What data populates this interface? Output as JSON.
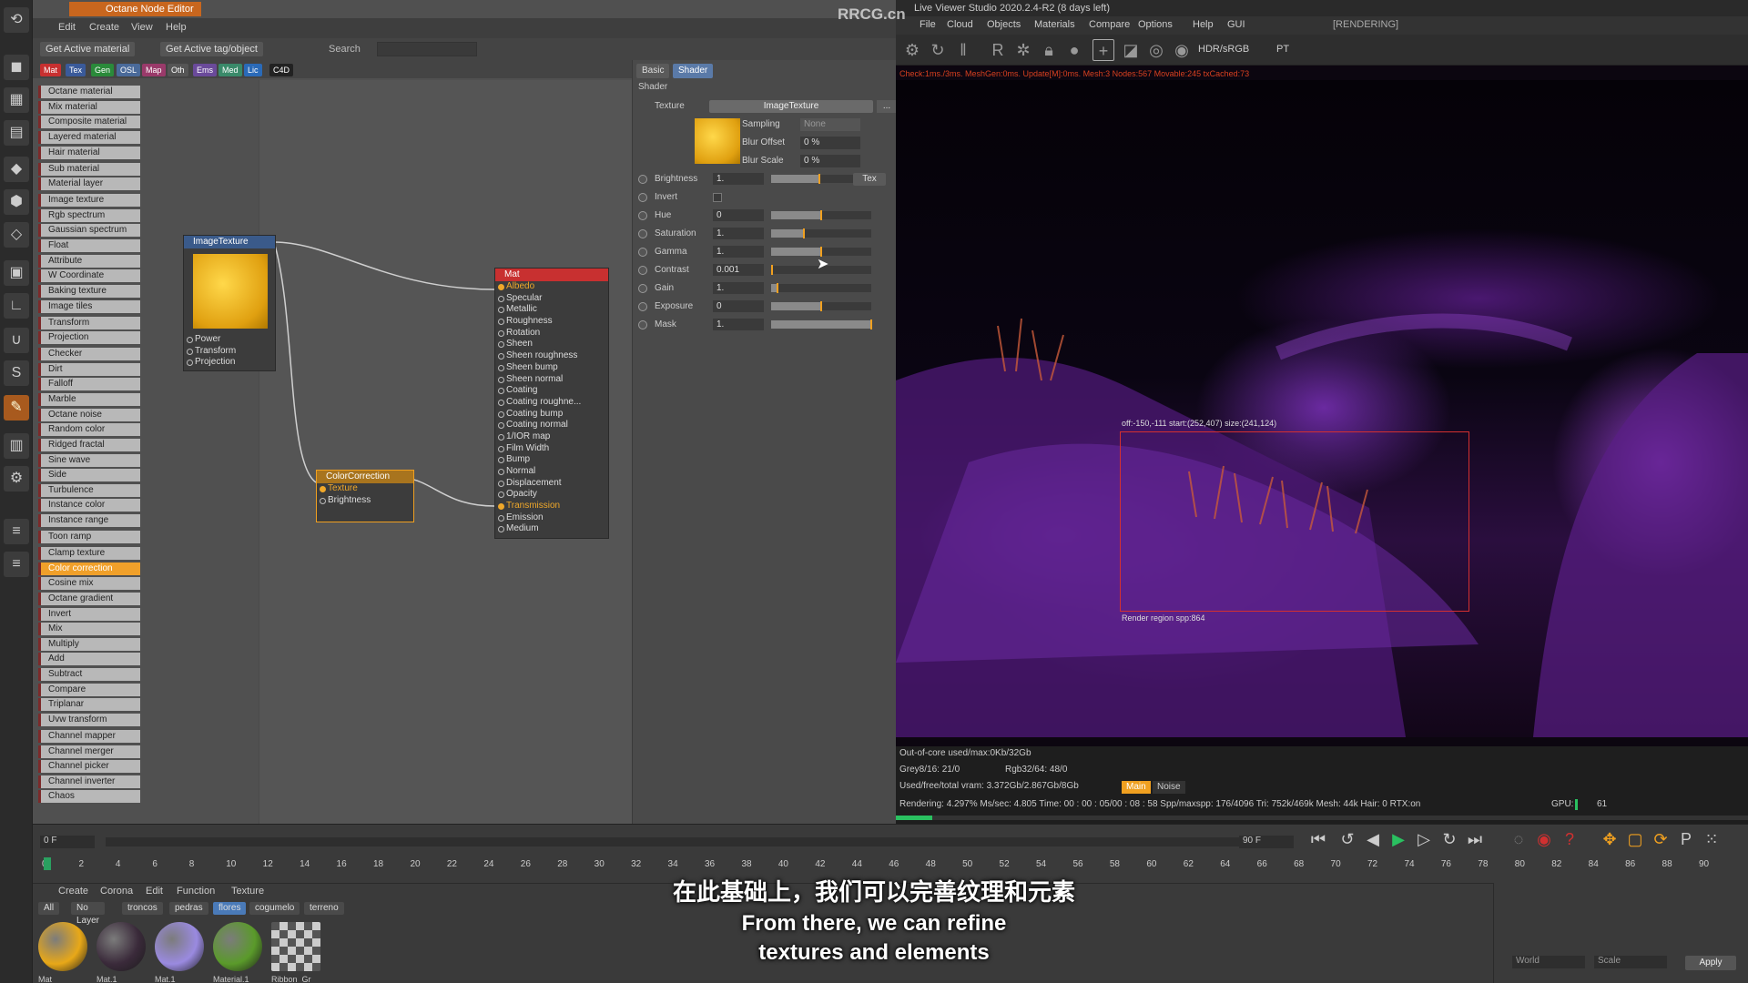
{
  "node_editor": {
    "title": "Octane Node Editor",
    "menu": [
      "Edit",
      "Create",
      "View",
      "Help"
    ],
    "toolbar": {
      "get_active_material": "Get Active material",
      "get_active_tag": "Get Active tag/object",
      "search_label": "Search"
    },
    "tags": [
      {
        "label": "Mat",
        "color": "#c83030"
      },
      {
        "label": "Tex",
        "color": "#3a5a9a"
      },
      {
        "label": "Gen",
        "color": "#2a8a3a"
      },
      {
        "label": "OSL",
        "color": "#4a6a9a"
      },
      {
        "label": "Map",
        "color": "#9a3a6a"
      },
      {
        "label": "Oth",
        "color": "#555555"
      },
      {
        "label": "Ems",
        "color": "#6a4a9a"
      },
      {
        "label": "Med",
        "color": "#3a8a6a"
      },
      {
        "label": "Lic",
        "color": "#2a6ab8"
      },
      {
        "label": "C4D",
        "color": "#222222"
      }
    ],
    "node_list": [
      "Octane material",
      "Mix material",
      "Composite material",
      "Layered material",
      "Hair material",
      "Sub material",
      "Material layer",
      "Image texture",
      "Rgb spectrum",
      "Gaussian spectrum",
      "Float",
      "Attribute",
      "W Coordinate",
      "Baking texture",
      "Image tiles",
      "Transform",
      "Projection",
      "Checker",
      "Dirt",
      "Falloff",
      "Marble",
      "Octane noise",
      "Random color",
      "Ridged fractal",
      "Sine wave",
      "Side",
      "Turbulence",
      "Instance color",
      "Instance range",
      "Toon ramp",
      "Clamp texture",
      "Color correction",
      "Cosine mix",
      "Octane gradient",
      "Invert",
      "Mix",
      "Multiply",
      "Add",
      "Subtract",
      "Compare",
      "Triplanar",
      "Uvw transform",
      "Channel mapper",
      "Channel merger",
      "Channel picker",
      "Channel inverter",
      "Chaos"
    ],
    "selected_node": "Color correction",
    "nodes": {
      "image_texture": {
        "title": "ImageTexture",
        "ports": [
          "Power",
          "Transform",
          "Projection"
        ]
      },
      "color_correction": {
        "title": "ColorCorrection",
        "ports": [
          "Texture",
          "Brightness"
        ]
      },
      "mat": {
        "title": "Mat",
        "ports": [
          "Albedo",
          "Specular",
          "Metallic",
          "Roughness",
          "Rotation",
          "Sheen",
          "Sheen roughness",
          "Sheen bump",
          "Sheen normal",
          "Coating",
          "Coating roughne...",
          "Coating bump",
          "Coating normal",
          "1/IOR map",
          "Film Width",
          "Bump",
          "Normal",
          "Displacement",
          "Opacity",
          "Transmission",
          "Emission",
          "Medium"
        ],
        "active_ports": [
          "Albedo",
          "Transmission"
        ]
      }
    }
  },
  "shader_panel": {
    "tabs": [
      "Basic",
      "Shader"
    ],
    "section": "Shader",
    "texture_label": "Texture",
    "texture_value": "ImageTexture",
    "texture_more": "...",
    "sampling_label": "Sampling",
    "sampling_value": "None",
    "blur_offset_label": "Blur Offset",
    "blur_offset_value": "0 %",
    "blur_scale_label": "Blur Scale",
    "blur_scale_value": "0 %",
    "tex_button": "Tex",
    "params": [
      {
        "label": "Brightness",
        "value": "1.",
        "fill": 0.48
      },
      {
        "label": "Invert",
        "value": "",
        "fill": 0
      },
      {
        "label": "Hue",
        "value": "0",
        "fill": 0.5
      },
      {
        "label": "Saturation",
        "value": "1.",
        "fill": 0.33
      },
      {
        "label": "Gamma",
        "value": "1.",
        "fill": 0.5
      },
      {
        "label": "Contrast",
        "value": "0.001",
        "fill": 0.01
      },
      {
        "label": "Gain",
        "value": "1.",
        "fill": 0.06
      },
      {
        "label": "Exposure",
        "value": "0",
        "fill": 0.5
      },
      {
        "label": "Mask",
        "value": "1.",
        "fill": 1.0
      }
    ]
  },
  "live_viewer": {
    "title": "Live Viewer Studio 2020.2.4-R2 (8 days left)",
    "menu": [
      "File",
      "Cloud",
      "Objects",
      "Materials",
      "Compare",
      "Options",
      "Help",
      "GUI"
    ],
    "status": "[RENDERING]",
    "color_space": "HDR/sRGB",
    "kernel": "PT",
    "stats_top": "Check:1ms./3ms. MeshGen:0ms. Update[M]:0ms. Mesh:3 Nodes:567 Movable:245 txCached:73",
    "region_top_label": "off:-150,-111 start:(252,407) size:(241,124)",
    "region_bottom_label": "Render region spp:864",
    "out_of_core": "Out-of-core used/max:0Kb/32Gb",
    "grey": "Grey8/16: 21/0",
    "rgb": "Rgb32/64: 48/0",
    "vram": "Used/free/total vram: 3.372Gb/2.867Gb/8Gb",
    "main_tag": "Main",
    "noise_tag": "Noise",
    "render_stats": "Rendering: 4.297%   Ms/sec: 4.805   Time: 00 : 00 : 05/00 : 08 : 58   Spp/maxspp: 176/4096   Tri: 752k/469k   Mesh: 44k   Hair: 0   RTX:on",
    "gpu_label": "GPU:",
    "gpu_value": "61",
    "progress": 0.043
  },
  "timeline": {
    "start_frame": "0 F",
    "end_frame": "90 F",
    "ticks": [
      "0",
      "2",
      "4",
      "6",
      "8",
      "10",
      "12",
      "14",
      "16",
      "18",
      "20",
      "22",
      "24",
      "26",
      "28",
      "30",
      "32",
      "34",
      "36",
      "38",
      "40",
      "42",
      "44",
      "46",
      "48",
      "50",
      "52",
      "54",
      "56",
      "58",
      "60",
      "62",
      "64",
      "66",
      "68",
      "70",
      "72",
      "74",
      "76",
      "78",
      "80",
      "82",
      "84",
      "86",
      "88",
      "90"
    ]
  },
  "material_manager": {
    "menu": [
      "Create",
      "Corona",
      "Edit",
      "Function",
      "Texture"
    ],
    "filters": [
      "All",
      "No Layer",
      "troncos",
      "pedras",
      "flores",
      "cogumelo",
      "terreno"
    ],
    "active_filter": "flores",
    "materials": [
      {
        "label": "Mat",
        "color": "#e8a818"
      },
      {
        "label": "Mat.1",
        "color": "#3a2a3a"
      },
      {
        "label": "Mat.1",
        "color": "#9a8ae0"
      },
      {
        "label": "Material.1",
        "color": "#5a9a2a"
      },
      {
        "label": "Ribbon_Gr",
        "color": "#888888"
      }
    ]
  },
  "attributes": {
    "world_label": "World",
    "scale_label": "Scale",
    "apply_button": "Apply"
  },
  "subtitles": {
    "cn": "在此基础上，我们可以完善纹理和元素",
    "en1": "From there, we can refine",
    "en2": "textures and elements"
  },
  "watermark": "RRCG.cn"
}
